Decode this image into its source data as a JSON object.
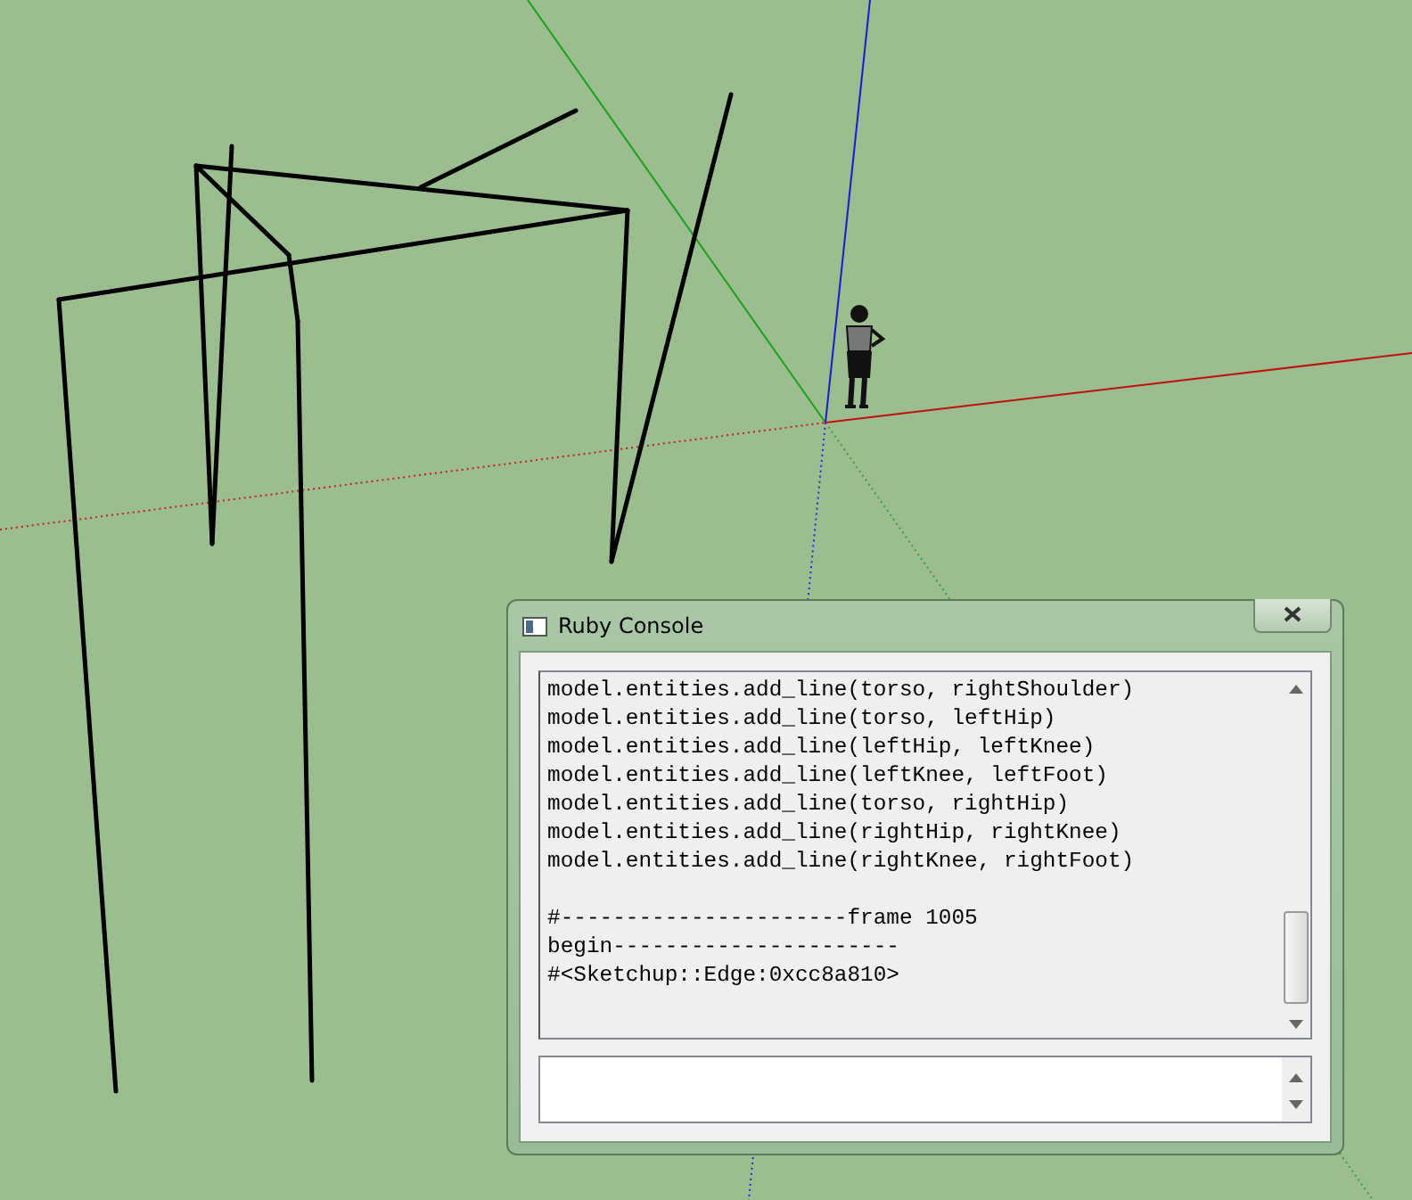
{
  "console": {
    "title": "Ruby Console",
    "output_blocks": [
      [
        "model.entities.add_line(torso, rightShoulder)",
        "model.entities.add_line(torso, leftHip)",
        "model.entities.add_line(leftHip, leftKnee)",
        "model.entities.add_line(leftKnee, leftFoot)",
        "model.entities.add_line(torso, rightHip)",
        "model.entities.add_line(rightHip, rightKnee)",
        "model.entities.add_line(rightKnee, rightFoot)"
      ],
      [
        "#----------------------frame 1005",
        "begin----------------------",
        "#<Sketchup::Edge:0xcc8a810>"
      ]
    ]
  }
}
